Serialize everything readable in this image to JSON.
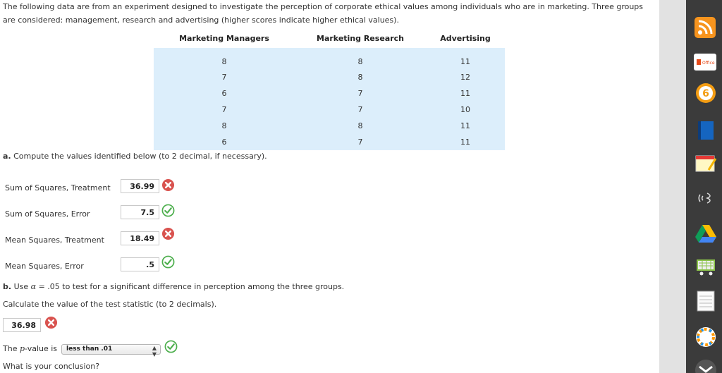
{
  "intro": "The following data are from an experiment designed to investigate the perception of corporate ethical values among individuals who are in marketing. Three groups are considered: management, research and advertising (higher scores indicate higher ethical values).",
  "table": {
    "headers": [
      "Marketing Managers",
      "Marketing Research",
      "Advertising"
    ],
    "rows": [
      [
        "8",
        "8",
        "11"
      ],
      [
        "7",
        "8",
        "12"
      ],
      [
        "6",
        "7",
        "11"
      ],
      [
        "7",
        "7",
        "10"
      ],
      [
        "8",
        "8",
        "11"
      ],
      [
        "6",
        "7",
        "11"
      ]
    ]
  },
  "part_a": {
    "prefix": "a.",
    "instruction": "Compute the values identified below (to 2 decimal, if necessary).",
    "fields": [
      {
        "label": "Sum of Squares, Treatment",
        "value": "36.99",
        "status": "incorrect"
      },
      {
        "label": "Sum of Squares, Error",
        "value": "7.5",
        "status": "correct"
      },
      {
        "label": "Mean Squares, Treatment",
        "value": "18.49",
        "status": "incorrect"
      },
      {
        "label": "Mean Squares, Error",
        "value": ".5",
        "status": "correct"
      }
    ]
  },
  "part_b": {
    "prefix": "b.",
    "use_text_1": "Use",
    "alpha": "α",
    "equals": "=",
    "use_text_2": ".05 to test for a significant difference in perception among the three groups.",
    "calc_text": "Calculate the value of the test statistic (to 2 decimals).",
    "test_stat_value": "36.98",
    "test_stat_status": "incorrect",
    "pvalue_prefix": "The",
    "pvalue_symbol": "p",
    "pvalue_suffix": "-value is",
    "pvalue_selected": "less than .01",
    "pvalue_status": "correct",
    "conclusion_question": "What is your conclusion?"
  },
  "dock": {
    "icons": [
      "rss-icon",
      "office-icon",
      "badge-6-icon",
      "book-icon",
      "notes-icon",
      "radar-icon",
      "google-drive-icon",
      "cart-icon",
      "notepad-icon",
      "color-wheel-icon",
      "mail-icon"
    ],
    "office_label": "Office",
    "badge_label": "6"
  },
  "colors": {
    "table_bg": "#dceefb",
    "incorrect": "#d9534f",
    "correct": "#4cae4c"
  }
}
